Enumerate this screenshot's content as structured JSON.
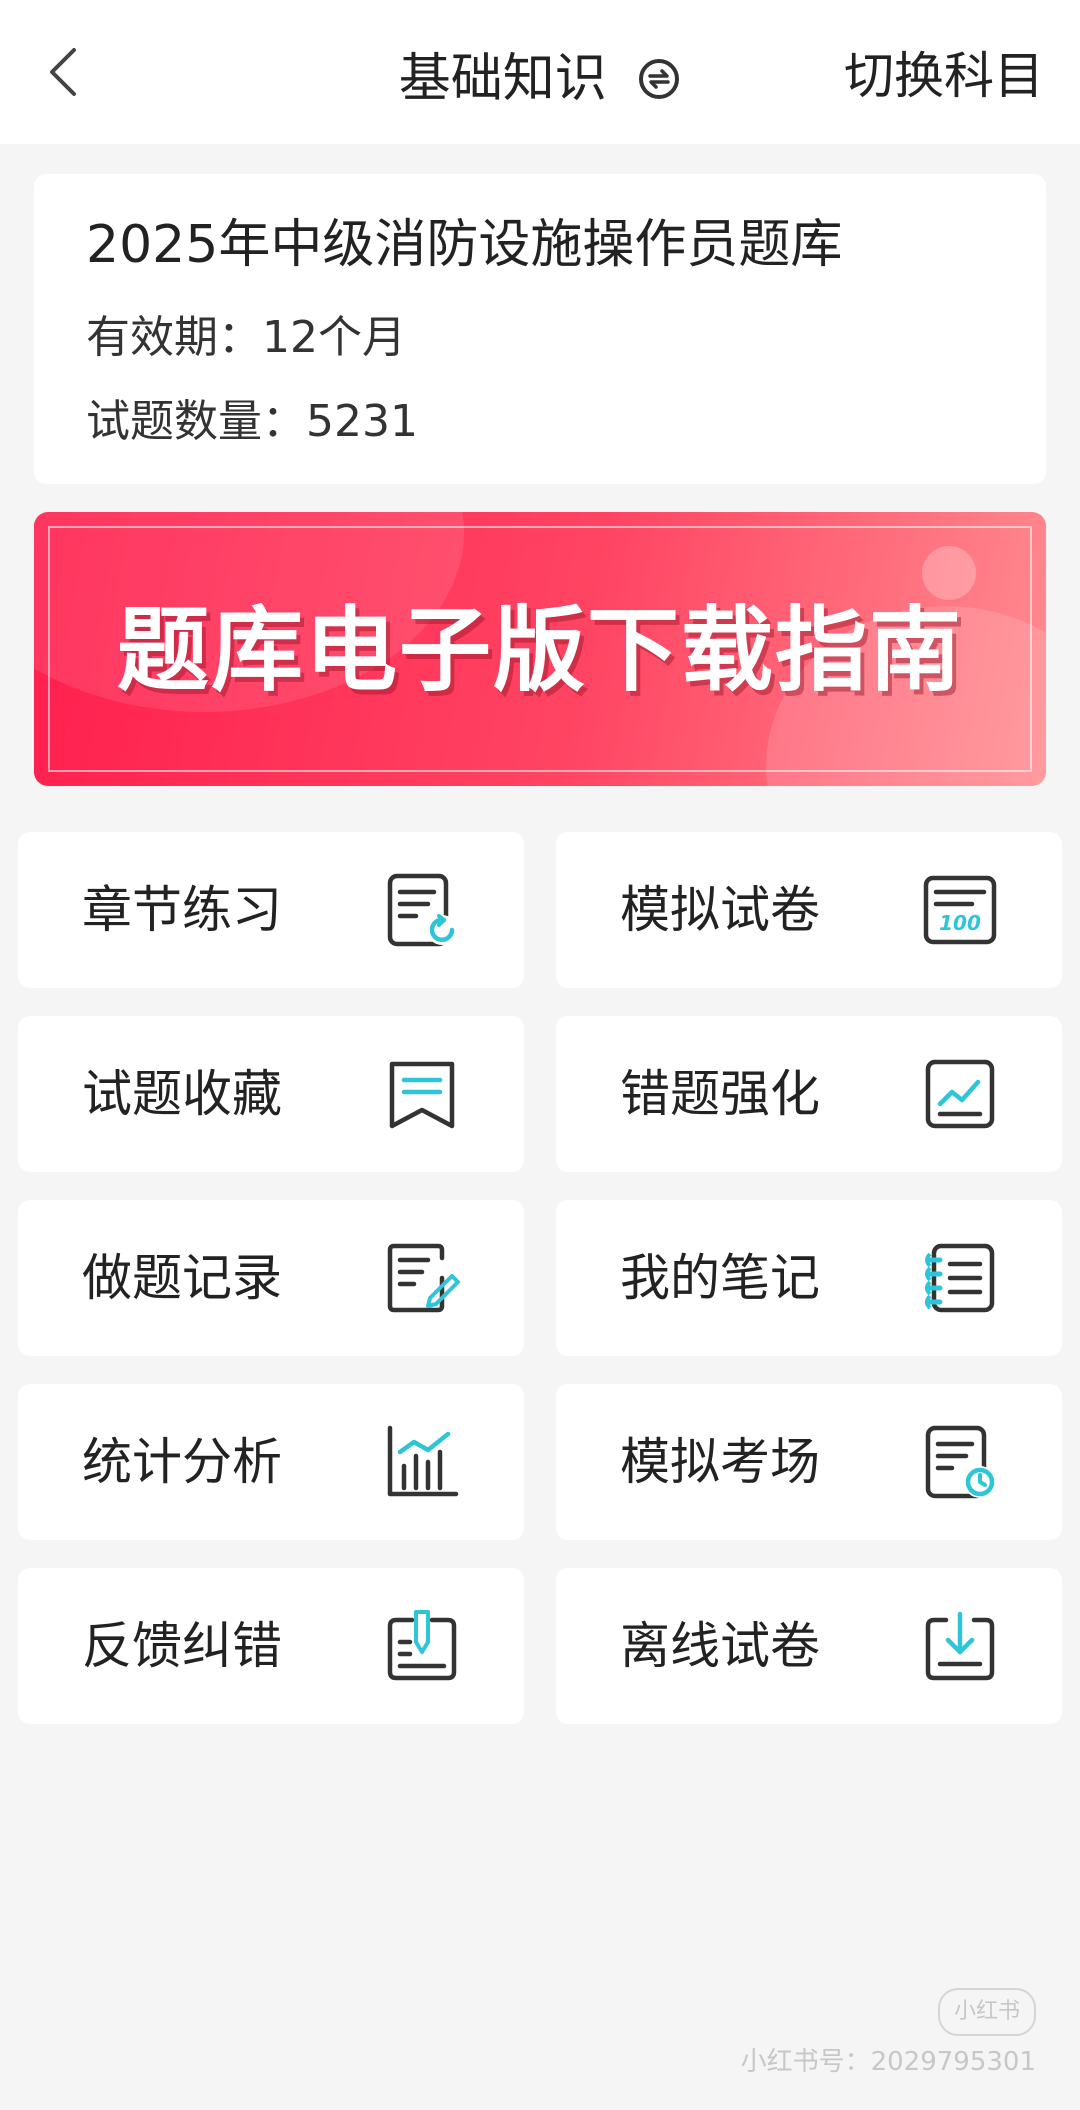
{
  "header": {
    "title": "基础知识",
    "switch_label": "切换科目"
  },
  "info": {
    "title": "2025年中级消防设施操作员题库",
    "validity": "有效期：12个月",
    "count": "试题数量：5231"
  },
  "banner": {
    "text": "题库电子版下载指南"
  },
  "tiles": [
    {
      "label": "章节练习",
      "icon": "chapter-practice-icon"
    },
    {
      "label": "模拟试卷",
      "icon": "mock-paper-icon"
    },
    {
      "label": "试题收藏",
      "icon": "bookmark-icon"
    },
    {
      "label": "错题强化",
      "icon": "chart-board-icon"
    },
    {
      "label": "做题记录",
      "icon": "edit-record-icon"
    },
    {
      "label": "我的笔记",
      "icon": "notebook-icon"
    },
    {
      "label": "统计分析",
      "icon": "bar-chart-icon"
    },
    {
      "label": "模拟考场",
      "icon": "exam-clock-icon"
    },
    {
      "label": "反馈纠错",
      "icon": "feedback-pen-icon"
    },
    {
      "label": "离线试卷",
      "icon": "download-icon"
    }
  ],
  "watermark": {
    "badge": "小红书",
    "text": "小红书号：2029795301"
  },
  "colors": {
    "accent_teal": "#2ec5d8",
    "icon_dark": "#333333",
    "banner_red": "#ff2a52"
  }
}
